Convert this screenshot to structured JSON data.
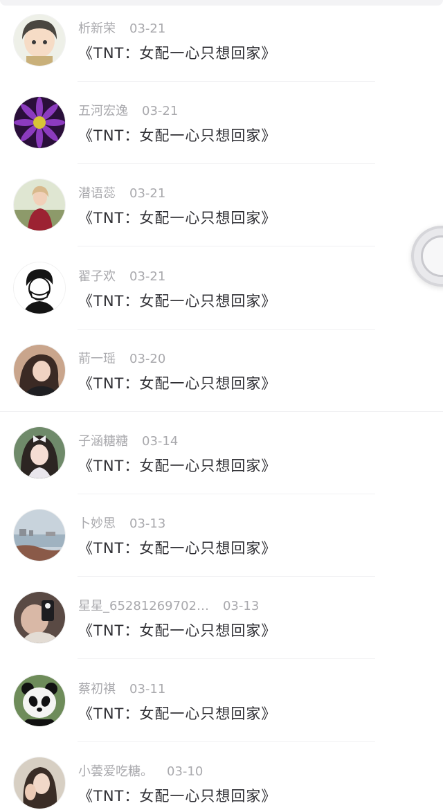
{
  "items": [
    {
      "name": "析新荣",
      "date": "03-21",
      "title": "《TNT：女配一心只想回家》",
      "avatar": "boy-anime-avatar"
    },
    {
      "name": "五河宏逸",
      "date": "03-21",
      "title": "《TNT：女配一心只想回家》",
      "avatar": "purple-flower-avatar"
    },
    {
      "name": "潜语蕊",
      "date": "03-21",
      "title": "《TNT：女配一心只想回家》",
      "avatar": "girl-red-coat-avatar"
    },
    {
      "name": "翟子欢",
      "date": "03-21",
      "title": "《TNT：女配一心只想回家》",
      "avatar": "masked-boy-avatar"
    },
    {
      "name": "葥一瑶",
      "date": "03-20",
      "title": "《TNT：女配一心只想回家》",
      "avatar": "girl-portrait-avatar"
    },
    {
      "name": "子涵糖糖",
      "date": "03-14",
      "title": "《TNT：女配一心只想回家》",
      "avatar": "girl-bow-avatar"
    },
    {
      "name": "卜妙思",
      "date": "03-13",
      "title": "《TNT：女配一心只想回家》",
      "avatar": "seaside-avatar"
    },
    {
      "name": "星星_65281269702…",
      "date": "03-13",
      "title": "《TNT：女配一心只想回家》",
      "avatar": "selfie-avatar"
    },
    {
      "name": "蔡初祺",
      "date": "03-11",
      "title": "《TNT：女配一心只想回家》",
      "avatar": "panda-avatar"
    },
    {
      "name": "小蕓爱吃糖。",
      "date": "03-10",
      "title": "《TNT：女配一心只想回家》",
      "avatar": "girl-hand-avatar"
    }
  ],
  "floating_button": {
    "icon": "smile-icon"
  }
}
